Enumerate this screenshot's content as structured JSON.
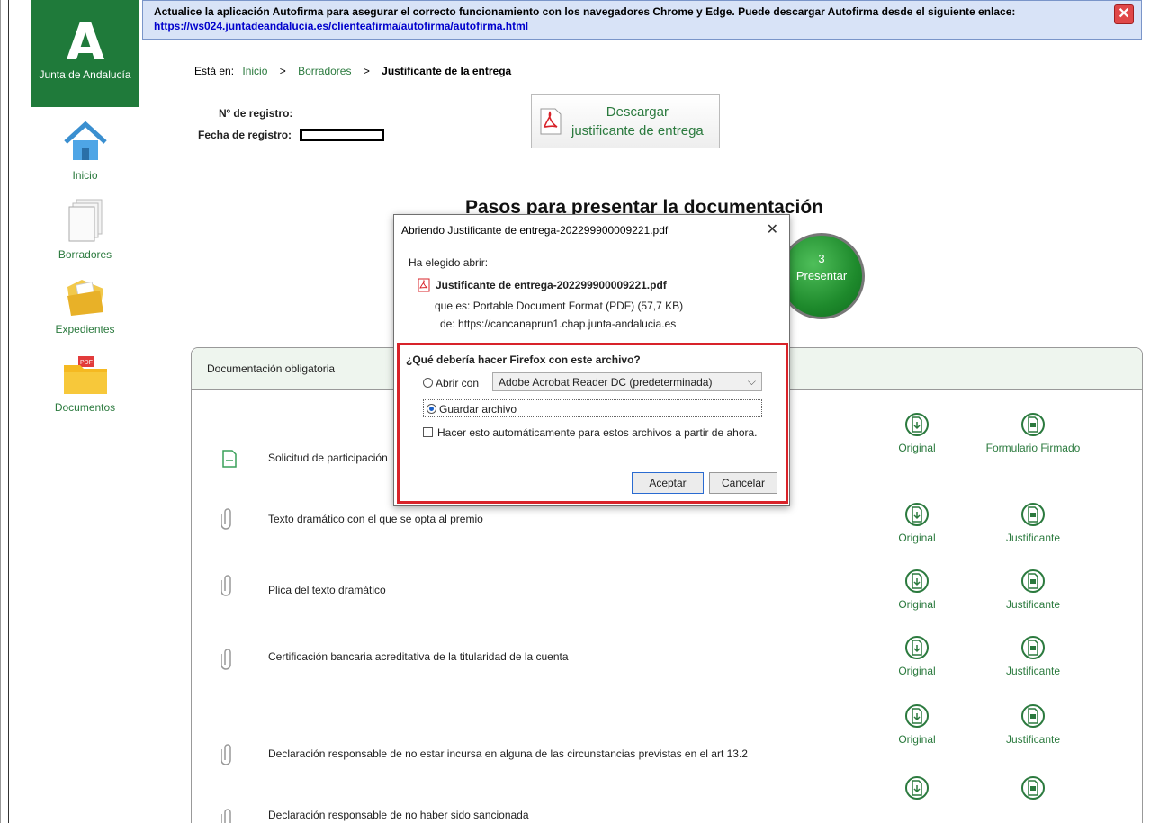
{
  "banner": {
    "text": "Actualice la aplicación Autofirma para asegurar el correcto funcionamiento con los navegadores Chrome y Edge. Puede descargar Autofirma desde el siguiente enlace:",
    "link": "https://ws024.juntadeandalucia.es/clienteafirma/autofirma/autofirma.html",
    "close_icon": "close-icon"
  },
  "logo": {
    "text": "Junta de Andalucía",
    "color": "#1f7a3a"
  },
  "sidebar": {
    "items": [
      {
        "label": "Inicio",
        "icon": "home-icon"
      },
      {
        "label": "Borradores",
        "icon": "documents-stack-icon"
      },
      {
        "label": "Expedientes",
        "icon": "folder-papers-icon"
      },
      {
        "label": "Documentos",
        "icon": "pdf-folder-icon"
      }
    ]
  },
  "breadcrumb": {
    "prefix": "Está en:",
    "items": [
      "Inicio",
      "Borradores"
    ],
    "sep": ">",
    "current": "Justificante de la entrega"
  },
  "registro": {
    "numero_label": "Nº de registro:",
    "fecha_label": "Fecha de registro:"
  },
  "download": {
    "line1": "Descargar",
    "line2": "justificante de entrega"
  },
  "steps": {
    "title": "Pasos para presentar la documentación",
    "step_number": "3",
    "step_label": "Presentar"
  },
  "panel": {
    "title": "Documentación obligatoria",
    "rows": [
      {
        "label": "Solicitud de participación",
        "icon": "document-icon",
        "action1": "Original",
        "action2": "Formulario Firmado"
      },
      {
        "label": "Texto dramático con el que se opta al premio",
        "icon": "paperclip-icon",
        "action1": "Original",
        "action2": "Justificante"
      },
      {
        "label": "Plica del texto dramático",
        "icon": "paperclip-icon",
        "action1": "Original",
        "action2": "Justificante"
      },
      {
        "label": "Certificación bancaria acreditativa de la titularidad de la cuenta",
        "icon": "paperclip-icon",
        "action1": "Original",
        "action2": "Justificante"
      },
      {
        "label": "Declaración responsable de no estar incursa en alguna de las circunstancias previstas en el art 13.2",
        "icon": "paperclip-icon",
        "action1": "Original",
        "action2": "Justificante"
      },
      {
        "label": "Declaración responsable de no haber sido sancionada",
        "icon": "paperclip-icon",
        "action1": "",
        "action2": ""
      }
    ]
  },
  "dialog": {
    "title": "Abriendo Justificante de entrega-202299900009221.pdf",
    "subtitle": "Ha elegido abrir:",
    "filename": "Justificante de entrega-202299900009221.pdf",
    "type_label": "que es:",
    "type_value": "Portable Document Format (PDF) (57,7 KB)",
    "from_label": "de:",
    "from_value": "https://cancanaprun1.chap.junta-andalucia.es",
    "question": "¿Qué debería hacer Firefox con este archivo?",
    "open_with_label": "Abrir con",
    "open_with_value": "Adobe Acrobat Reader DC (predeterminada)",
    "save_label": "Guardar archivo",
    "auto_label": "Hacer esto automáticamente para estos archivos a partir de ahora.",
    "accept": "Aceptar",
    "cancel": "Cancelar",
    "highlight_color": "#d8232a"
  }
}
